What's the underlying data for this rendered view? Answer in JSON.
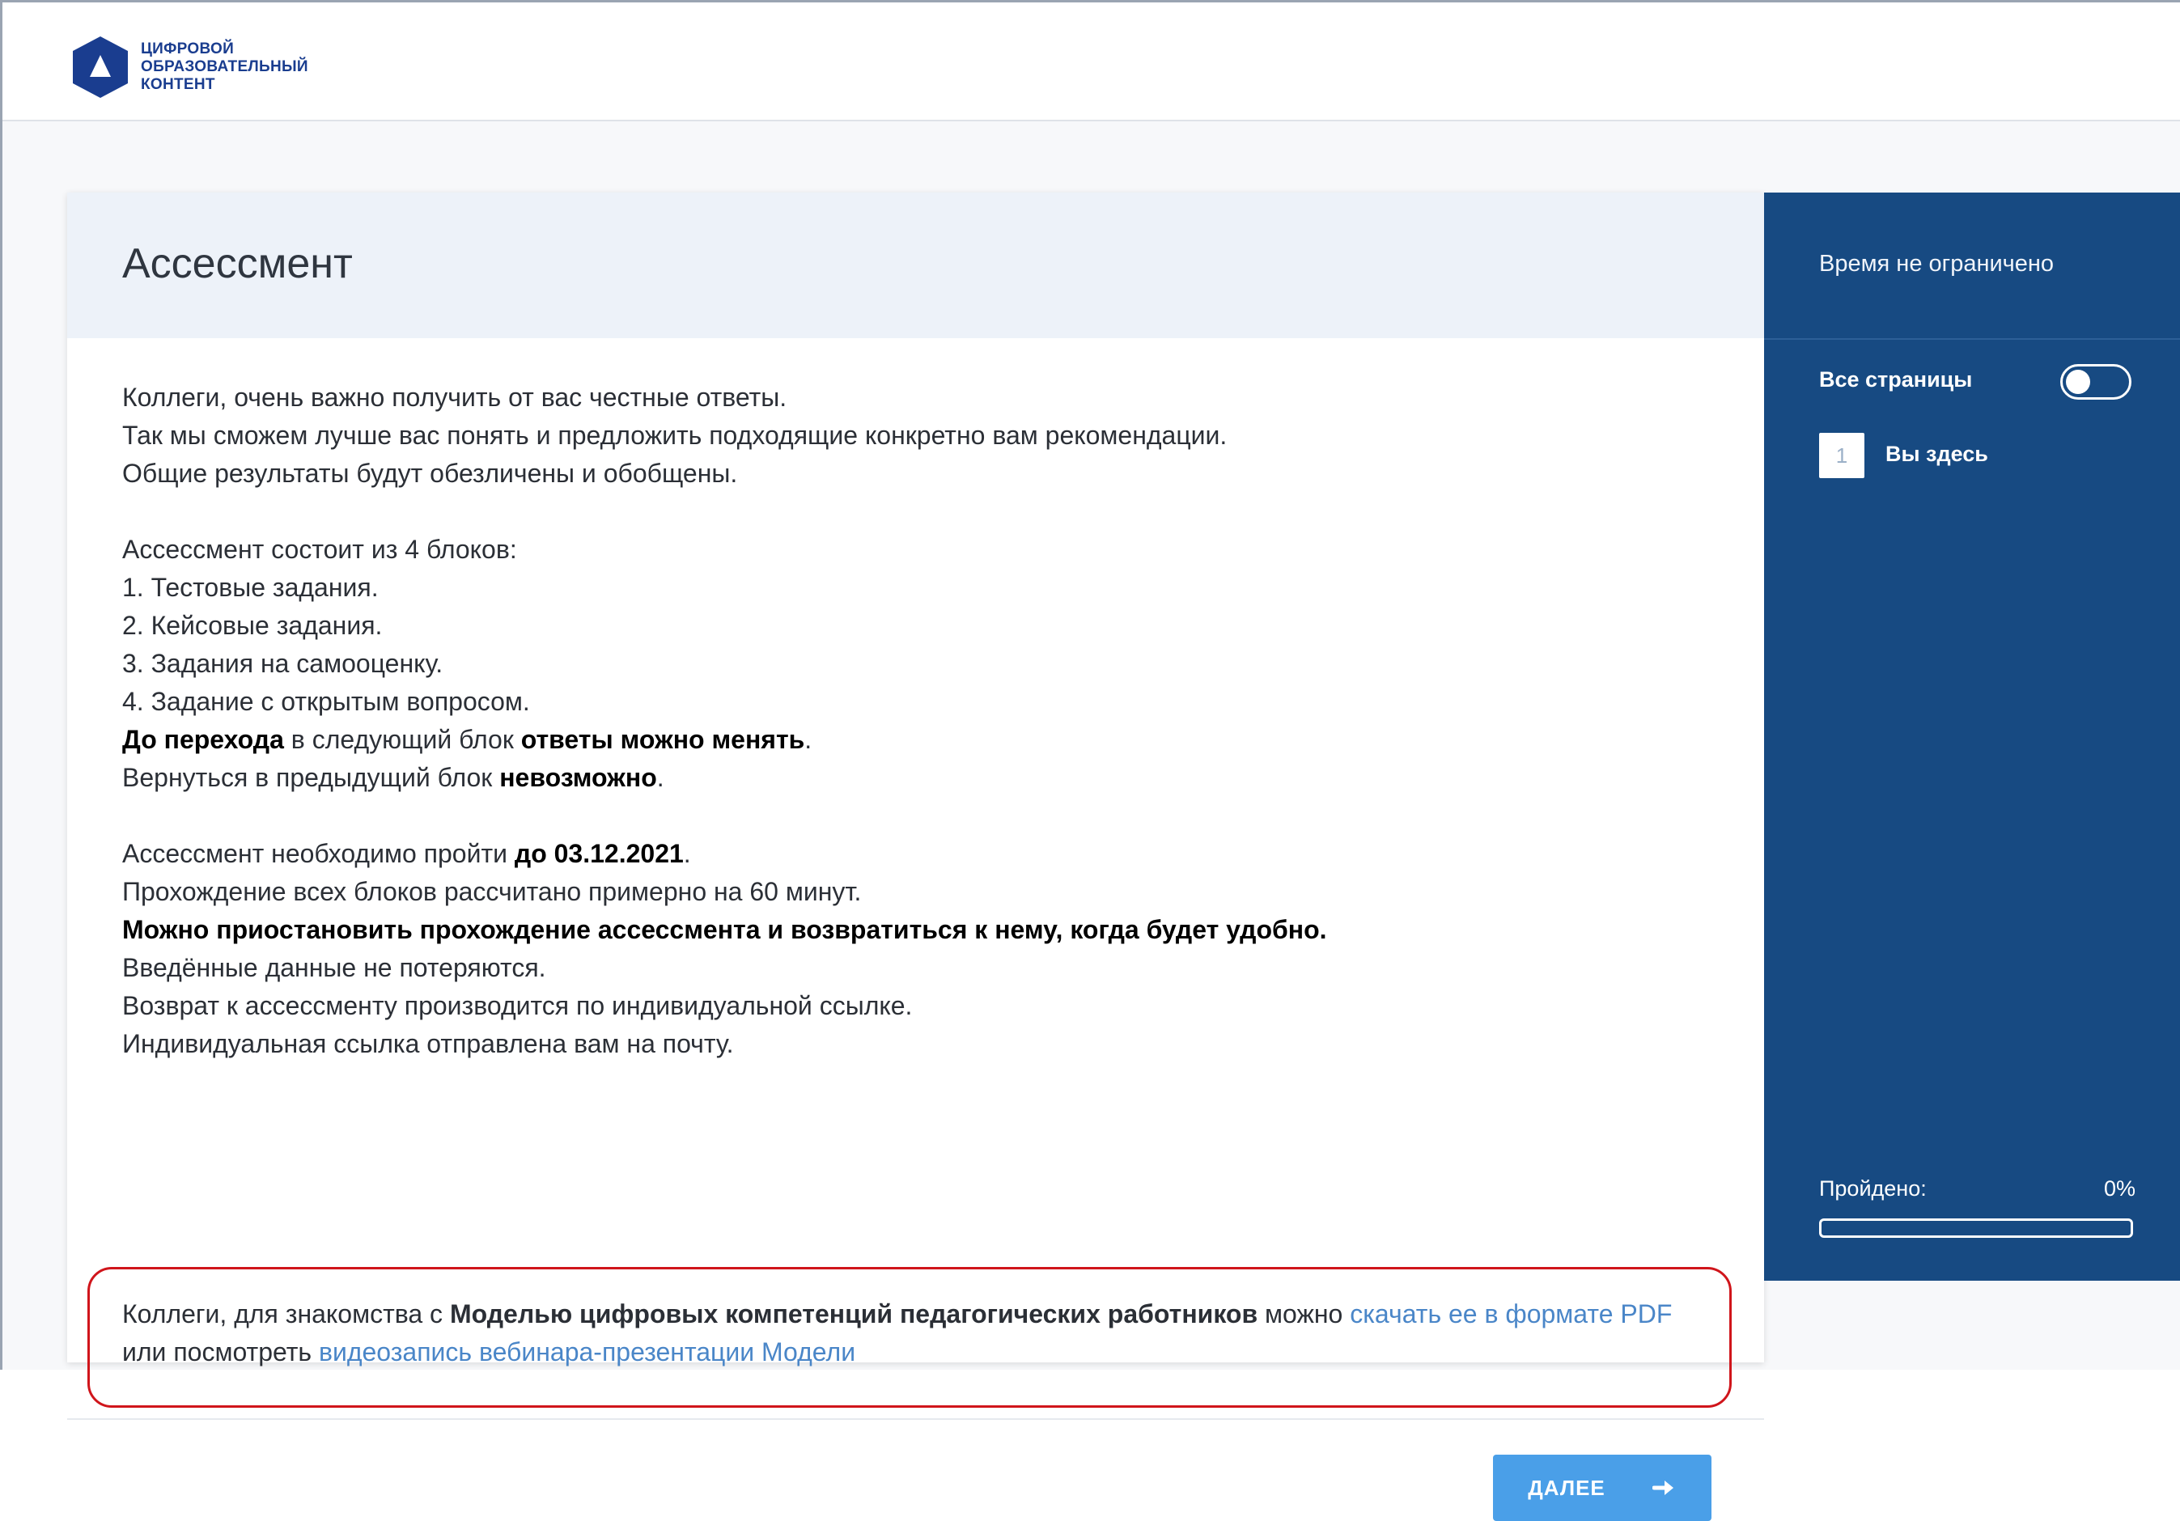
{
  "logo": {
    "line1": "ЦИФРОВОЙ",
    "line2": "ОБРАЗОВАТЕЛЬНЫЙ",
    "line3": "КОНТЕНТ",
    "brand_color": "#1a3d8f"
  },
  "page_title": "Ассессмент",
  "intro": {
    "line1": "Коллеги, очень важно получить от вас честные ответы.",
    "line2": "Так мы сможем лучше вас понять и предложить подходящие конкретно вам рекомендации.",
    "line3": "Общие результаты будут обезличены и обобщены."
  },
  "blocks": {
    "heading": "Ассессмент состоит из 4 блоков:",
    "items": [
      "1. Тестовые задания.",
      "2. Кейсовые задания.",
      "3. Задания на самооценку.",
      "4. Задание с открытым вопросом."
    ],
    "change_bold1": "До перехода",
    "change_mid": " в следующий блок ",
    "change_bold2": "ответы можно менять",
    "change_end": ".",
    "back_start": "Вернуться в предыдущий блок ",
    "back_bold": "невозможно",
    "back_end": "."
  },
  "deadline": {
    "start": "Ассессмент необходимо пройти ",
    "bold": "до 03.12.2021",
    "end": ".",
    "duration": "Прохождение всех блоков рассчитано примерно на 60 минут.",
    "pause": "Можно приостановить прохождение ассессмента и возвратиться к нему, когда будет удобно.",
    "saved": "Введённые данные не потеряются.",
    "return_link": "Возврат к ассессменту производится по индивидуальной ссылке.",
    "emailed": "Индивидуальная ссылка отправлена вам на почту."
  },
  "notice": {
    "start": "Коллеги, для знакомства с ",
    "bold": "Моделью цифровых компетенций педагогических работников",
    "mid": " можно ",
    "link_pdf": "скачать ее в формате PDF",
    "line2_start": "или посмотреть ",
    "link_video": "видеозапись вебинара-презентации Модели",
    "border_color": "#d0151b",
    "link_color": "#4a86c8"
  },
  "next_button": {
    "label": "ДАЛЕЕ",
    "icon": "arrow-right-icon",
    "color": "#4a9fe8"
  },
  "sidebar": {
    "time_text": "Время не ограничено",
    "all_pages_label": "Все страницы",
    "all_pages_on": false,
    "current_page": "1",
    "you_are_here": "Вы здесь",
    "passed_label": "Пройдено:",
    "passed_percent": "0%",
    "progress": 0,
    "bg_color": "#174a82"
  }
}
